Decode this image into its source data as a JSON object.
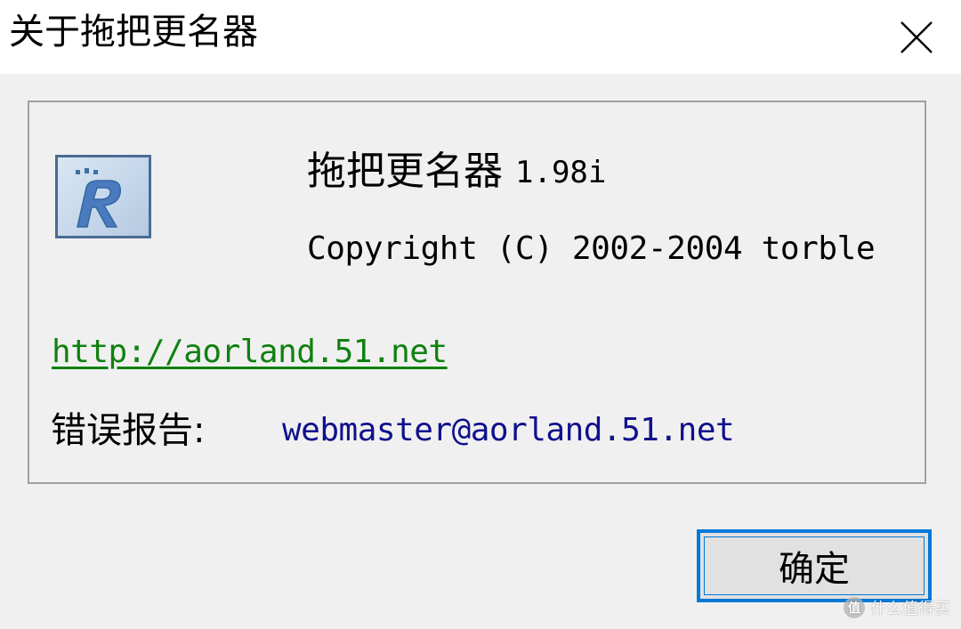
{
  "window": {
    "title": "关于拖把更名器",
    "close_icon": "close-icon"
  },
  "about": {
    "app_name": "拖把更名器",
    "version": "1.98i",
    "copyright": "Copyright (C) 2002-2004 torble",
    "icon": "app-logo-R-icon"
  },
  "links": {
    "website": "http://aorland.51.net",
    "report_label": "错误报告:",
    "report_email": "webmaster@aorland.51.net"
  },
  "buttons": {
    "ok_label": "确定"
  },
  "watermark": {
    "logo_char": "值",
    "text": "什么值得买"
  },
  "colors": {
    "link_green": "#108010",
    "email_blue": "#10108c",
    "focus_blue": "#0078d7"
  }
}
